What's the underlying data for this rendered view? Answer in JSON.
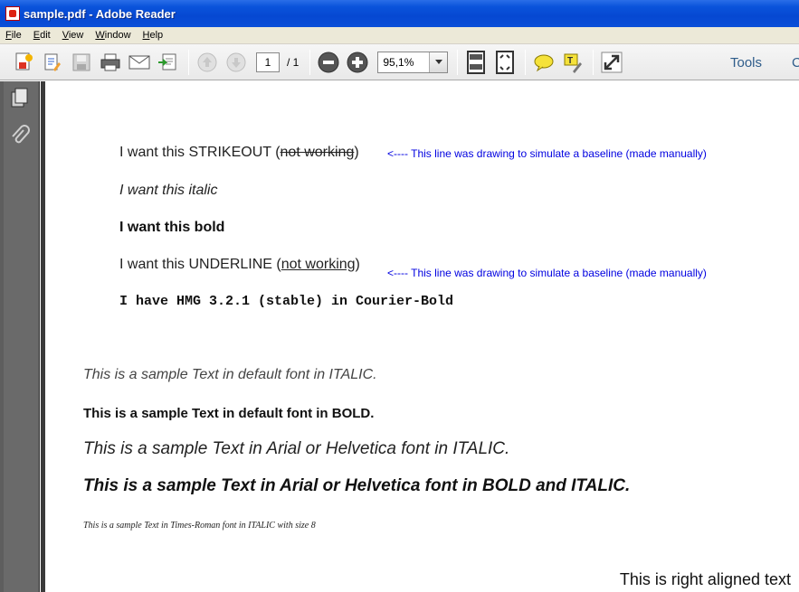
{
  "window": {
    "title": "sample.pdf - Adobe Reader"
  },
  "menu": [
    {
      "key": "F",
      "rest": "ile"
    },
    {
      "key": "E",
      "rest": "dit"
    },
    {
      "key": "V",
      "rest": "iew"
    },
    {
      "key": "W",
      "rest": "indow"
    },
    {
      "key": "H",
      "rest": "elp"
    }
  ],
  "toolbar": {
    "page_current": "1",
    "page_total": "/ 1",
    "zoom": "95,1%",
    "tools_label": "Tools",
    "comment_label": "C"
  },
  "document": {
    "strike_prefix": "I want this STRIKEOUT (",
    "strike_text": "not working",
    "strike_suffix": ")",
    "note_strike": "<----  This line was drawing to simulate a baseline (made manually)",
    "italic_line": "I want this italic",
    "bold_line": "I want this bold",
    "underline_prefix": "I want this UNDERLINE (",
    "underline_text": "not working",
    "underline_suffix": ")",
    "note_underline": "<----  This line was drawing to simulate a baseline (made manually)",
    "courier_line": "I have HMG 3.2.1 (stable) in Courier-Bold",
    "default_italic": "This is a sample Text in default font in ITALIC.",
    "default_bold": "This is a sample Text in default font in BOLD.",
    "arial_italic": "This is a sample Text in Arial or Helvetica font in ITALIC.",
    "arial_bold_italic": "This is a sample Text in Arial or Helvetica font in BOLD and ITALIC.",
    "times_italic": "This is a sample Text in Times-Roman font in ITALIC with size 8",
    "right_aligned": "This is right aligned text"
  }
}
